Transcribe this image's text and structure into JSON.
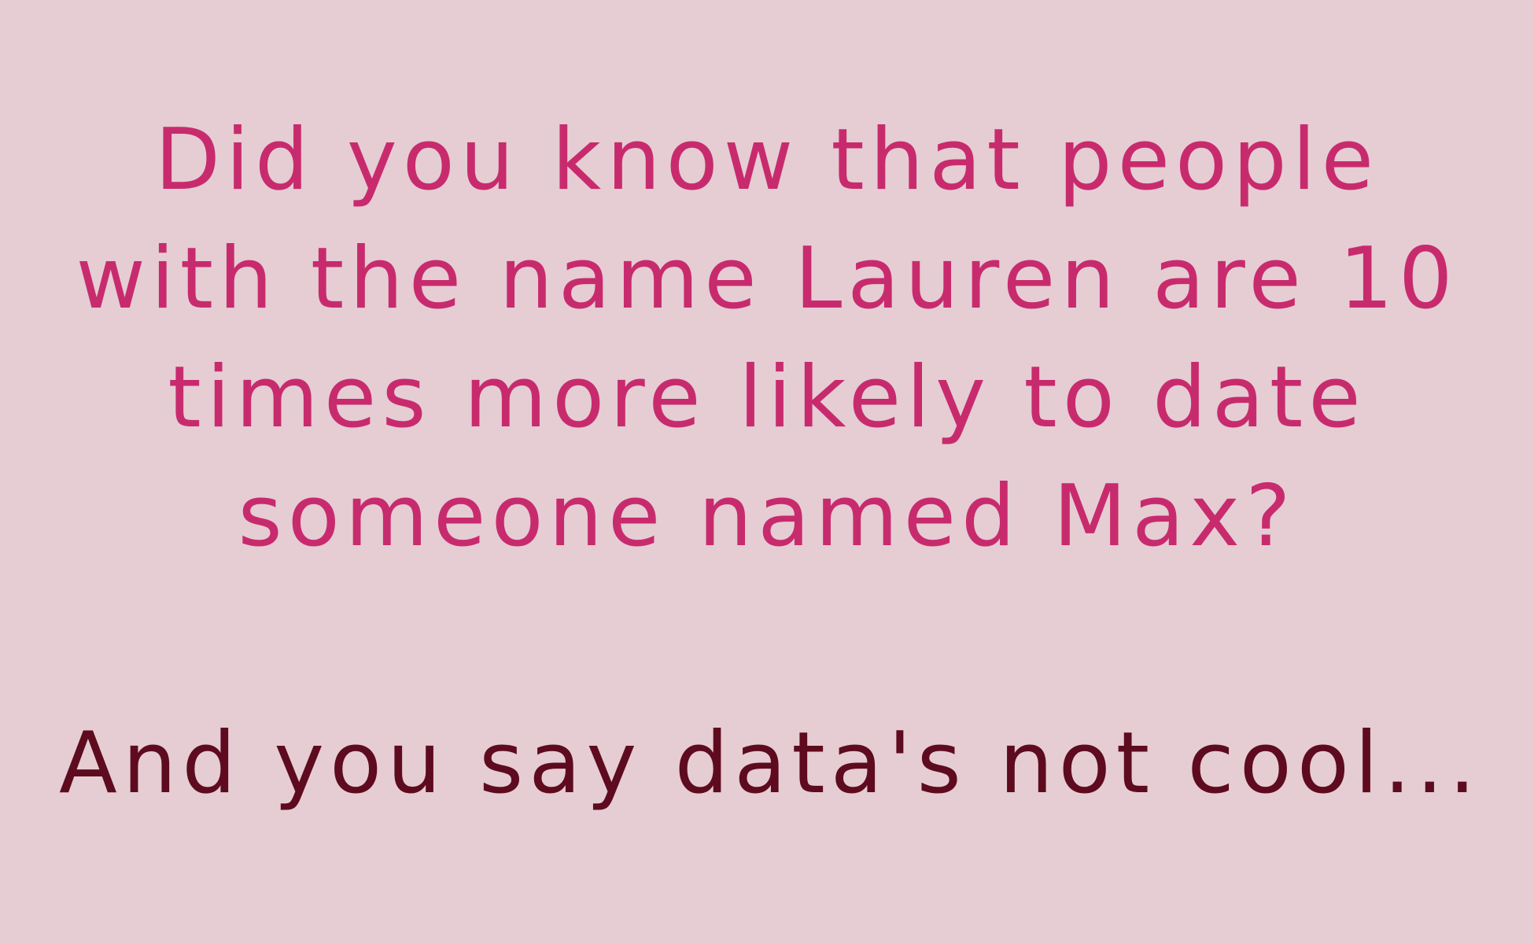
{
  "colors": {
    "background": "#e5cdd3",
    "question_text": "#c82b6d",
    "punchline_text": "#5e0b1f"
  },
  "question": {
    "lines": [
      "Did you know that people",
      "with the name Lauren are 10",
      "times more likely to date",
      "someone named Max?"
    ]
  },
  "punchline": {
    "text": "And you say data's not cool..."
  }
}
